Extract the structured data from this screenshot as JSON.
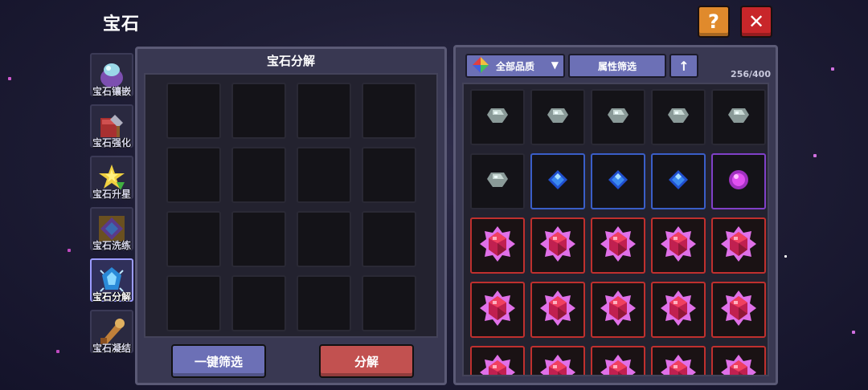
{
  "header": {
    "title": "宝石"
  },
  "top_buttons": {
    "help_label": "?",
    "close_label": "✕"
  },
  "sidebar": {
    "items": [
      {
        "label": "宝石镶嵌",
        "icon": "gem-socket-icon",
        "active": false
      },
      {
        "label": "宝石强化",
        "icon": "gem-enhance-icon",
        "active": false
      },
      {
        "label": "宝石升星",
        "icon": "star-upgrade-icon",
        "active": false
      },
      {
        "label": "宝石洗练",
        "icon": "gem-refine-icon",
        "active": false
      },
      {
        "label": "宝石分解",
        "icon": "gem-decompose-icon",
        "active": true
      },
      {
        "label": "宝石凝结",
        "icon": "gem-condense-icon",
        "active": false
      }
    ]
  },
  "decompose_panel": {
    "title": "宝石分解",
    "slot_rows": 4,
    "slot_cols": 4,
    "filter_button": "一键筛选",
    "decompose_button": "分解"
  },
  "inventory": {
    "quality_dropdown": "全部品质",
    "attribute_filter": "属性筛选",
    "sort_icon": "↑",
    "count": "256/400",
    "rows": [
      [
        "gray",
        "gray",
        "gray",
        "gray",
        "gray"
      ],
      [
        "gray",
        "blue",
        "blue",
        "blue",
        "purple"
      ],
      [
        "red",
        "red",
        "red",
        "red",
        "red"
      ],
      [
        "red",
        "red",
        "red",
        "red",
        "red"
      ],
      [
        "red",
        "red",
        "red",
        "red",
        "red"
      ]
    ]
  },
  "colors": {
    "button_blue": "#6c70b6",
    "button_red": "#c25150",
    "help_orange": "#e08a2c",
    "close_red": "#c8262a",
    "rarity_blue": "#3a5ec8",
    "rarity_purple": "#8040c8",
    "rarity_red": "#c0302e"
  }
}
